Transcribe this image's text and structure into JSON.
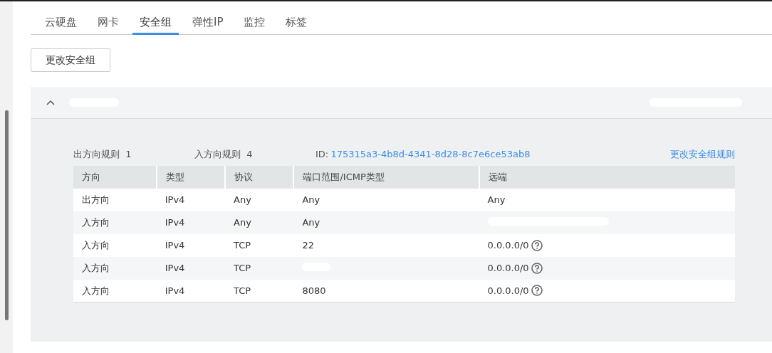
{
  "tabs": [
    {
      "label": "云硬盘",
      "selected": false
    },
    {
      "label": "网卡",
      "selected": false
    },
    {
      "label": "安全组",
      "selected": true
    },
    {
      "label": "弹性IP",
      "selected": false
    },
    {
      "label": "监控",
      "selected": false
    },
    {
      "label": "标签",
      "selected": false
    }
  ],
  "change_button": "更改安全组",
  "group": {
    "expanded": true,
    "name_redacted": true,
    "detail_redacted": true,
    "outbound_label": "出方向规则",
    "outbound_count": "1",
    "inbound_label": "入方向规则",
    "inbound_count": "4",
    "id_label": "ID:",
    "id_value": "175315a3-4b8d-4341-8d28-8c7e6ce53ab8",
    "edit_rules_link": "更改安全组规则"
  },
  "table": {
    "columns": [
      "方向",
      "类型",
      "协议",
      "端口范围/ICMP类型",
      "远端"
    ],
    "rows": [
      {
        "direction": "出方向",
        "type": "IPv4",
        "protocol": "Any",
        "port": "Any",
        "remote": "Any",
        "help": false
      },
      {
        "direction": "入方向",
        "type": "IPv4",
        "protocol": "Any",
        "port": "Any",
        "remote_redacted": true,
        "help": false
      },
      {
        "direction": "入方向",
        "type": "IPv4",
        "protocol": "TCP",
        "port": "22",
        "remote": "0.0.0.0/0",
        "help": true
      },
      {
        "direction": "入方向",
        "type": "IPv4",
        "protocol": "TCP",
        "port_redacted": true,
        "remote": "0.0.0.0/0",
        "help": true
      },
      {
        "direction": "入方向",
        "type": "IPv4",
        "protocol": "TCP",
        "port": "8080",
        "remote": "0.0.0.0/0",
        "help": true
      }
    ]
  }
}
